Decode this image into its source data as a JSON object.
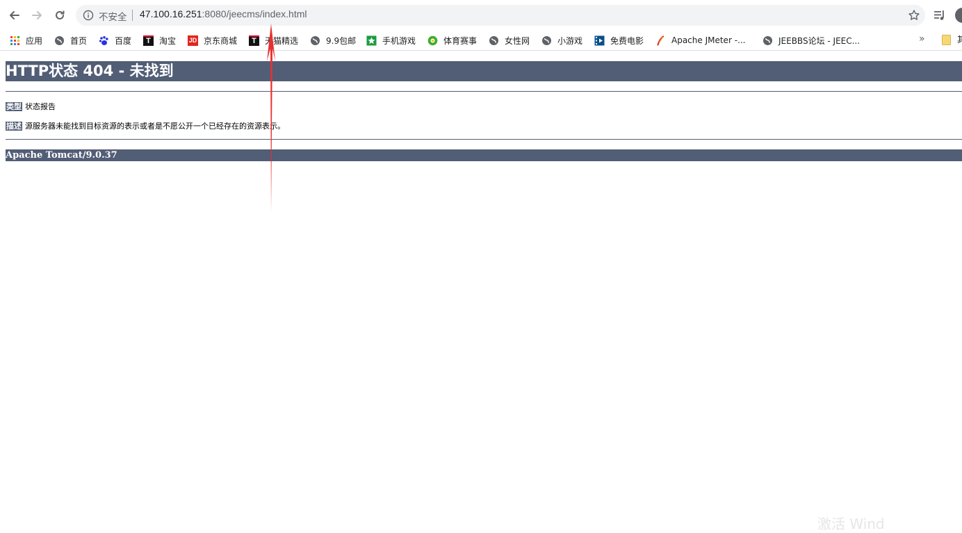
{
  "browser": {
    "omnibox": {
      "security_label": "不安全",
      "url_host": "47.100.16.251",
      "url_rest": ":8080/jeecms/index.html"
    },
    "bookmarks": [
      {
        "label": "应用",
        "icon": "apps-grid-icon"
      },
      {
        "label": "首页",
        "icon": "globe-icon"
      },
      {
        "label": "百度",
        "icon": "baidu-paw-icon"
      },
      {
        "label": "淘宝",
        "icon": "tmall-icon"
      },
      {
        "label": "京东商城",
        "icon": "jd-icon"
      },
      {
        "label": "天猫精选",
        "icon": "tmall-icon"
      },
      {
        "label": "9.9包邮",
        "icon": "globe-icon"
      },
      {
        "label": "手机游戏",
        "icon": "game-icon"
      },
      {
        "label": "体育赛事",
        "icon": "sports-ball-icon"
      },
      {
        "label": "女性网",
        "icon": "globe-icon"
      },
      {
        "label": "小游戏",
        "icon": "globe-icon"
      },
      {
        "label": "免费电影",
        "icon": "film-icon"
      },
      {
        "label": "Apache JMeter -...",
        "icon": "feather-icon"
      },
      {
        "label": "JEEBBS论坛 - JEEC...",
        "icon": "globe-icon"
      }
    ],
    "bookmarks_overflow": "»",
    "other_bookmarks_label": "其"
  },
  "page": {
    "heading": "HTTP状态 404 - 未找到",
    "type_key": "类型",
    "type_value": "状态报告",
    "desc_key": "描述",
    "desc_value": "源服务器未能找到目标资源的表示或者是不愿公开一个已经存在的资源表示。",
    "footer": "Apache Tomcat/9.0.37"
  },
  "watermark": "激活 Wind",
  "colors": {
    "tomcat_header": "#525d76",
    "annotation_arrow": "#e8312f"
  }
}
